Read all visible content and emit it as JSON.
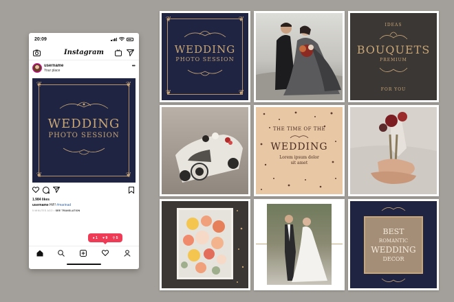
{
  "status_bar": {
    "time": "20:09"
  },
  "app_bar": {
    "title": "Instagram"
  },
  "post": {
    "username": "username",
    "place": "Your place",
    "image": {
      "line1": "WEDDING",
      "line2": "PHOTO SESSION"
    },
    "likes": "1.984 likes",
    "caption_user": "username",
    "caption_text": "Hi!!!",
    "caption_tag": "#marinad",
    "time_ago": "5 MINUTES AGO",
    "translate_label": "SEE TRANSLATION"
  },
  "notification": {
    "comments": "1",
    "likes": "9",
    "follows": "5"
  },
  "tabs": [
    "home",
    "search",
    "add",
    "activity",
    "profile"
  ],
  "grid": {
    "t1": {
      "line1": "WEDDING",
      "line2": "PHOTO SESSION"
    },
    "t3": {
      "top": "IDEAS",
      "title": "BOUQUETS",
      "sub": "PREMIUM",
      "bottom": "FOR YOU"
    },
    "t5": {
      "line1": "THE TIME OF THE",
      "title": "WEDDING",
      "body1": "Lorem ipsum dolor",
      "body2": "sit amet"
    },
    "t9": {
      "line1": "BEST",
      "line2": "ROMANTIC",
      "line3": "WEDDING",
      "line4": "DECOR"
    }
  },
  "colors": {
    "navy": "#1e2442",
    "gold": "#c9a676",
    "charcoal": "#3b3734",
    "peach": "#e8c7a4",
    "notif_red": "#ee3c57"
  }
}
